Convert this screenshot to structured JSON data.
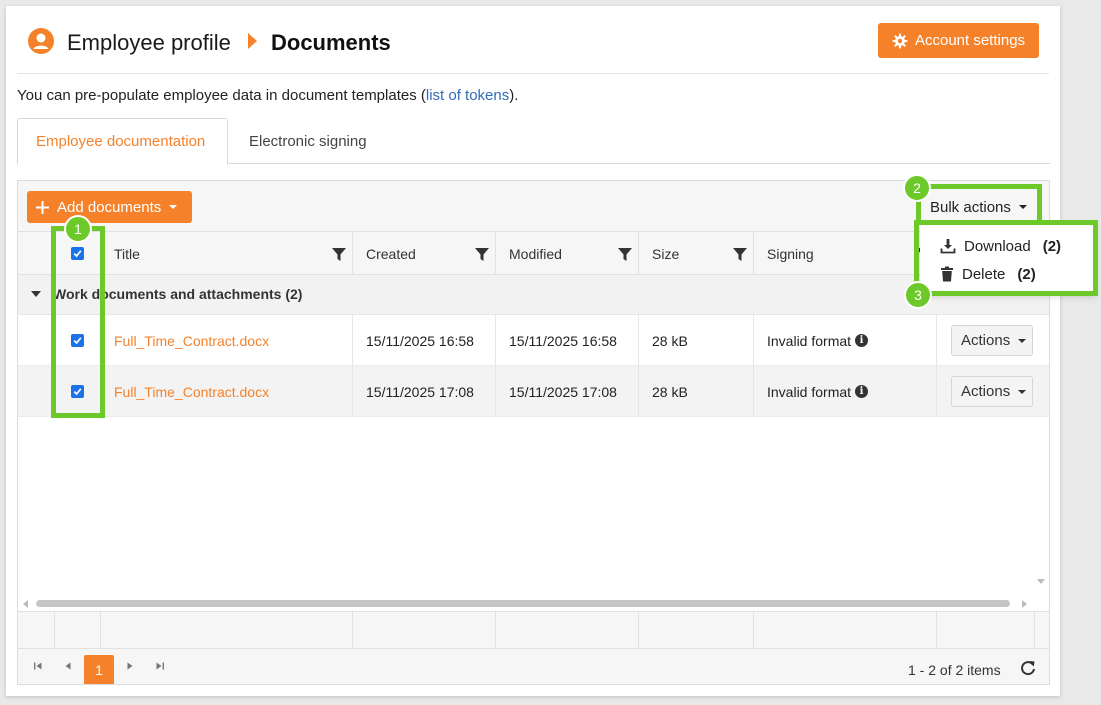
{
  "header": {
    "breadcrumb_parent": "Employee profile",
    "breadcrumb_current": "Documents",
    "account_settings_label": "Account settings"
  },
  "intro": {
    "text_before": "You can pre-populate employee data in document templates (",
    "link_text": "list of tokens",
    "text_after": ")."
  },
  "tabs": [
    {
      "label": "Employee documentation",
      "active": true
    },
    {
      "label": "Electronic signing",
      "active": false
    }
  ],
  "toolbar": {
    "add_documents_label": "Add documents",
    "bulk_actions_label": "Bulk actions"
  },
  "table": {
    "columns": [
      "Title",
      "Created",
      "Modified",
      "Size",
      "Signing"
    ],
    "group_label": "Work documents and attachments (2)",
    "rows": [
      {
        "title": "Full_Time_Contract.docx",
        "created": "15/11/2025 16:58",
        "modified": "15/11/2025 16:58",
        "size": "28 kB",
        "signing": "Invalid format",
        "checked": true,
        "actions_label": "Actions"
      },
      {
        "title": "Full_Time_Contract.docx",
        "created": "15/11/2025 17:08",
        "modified": "15/11/2025 17:08",
        "size": "28 kB",
        "signing": "Invalid format",
        "checked": true,
        "actions_label": "Actions"
      }
    ]
  },
  "bulk_menu": {
    "download_label": "Download",
    "download_count": "(2)",
    "delete_label": "Delete",
    "delete_count": "(2)"
  },
  "pager": {
    "current_page": "1",
    "info": "1 - 2 of 2 items"
  },
  "annotations": [
    "1",
    "2",
    "3"
  ],
  "colors": {
    "accent": "#f5822a",
    "highlight": "#6dc92a",
    "link": "#2f6eb5",
    "checkbox": "#1a73e8"
  }
}
